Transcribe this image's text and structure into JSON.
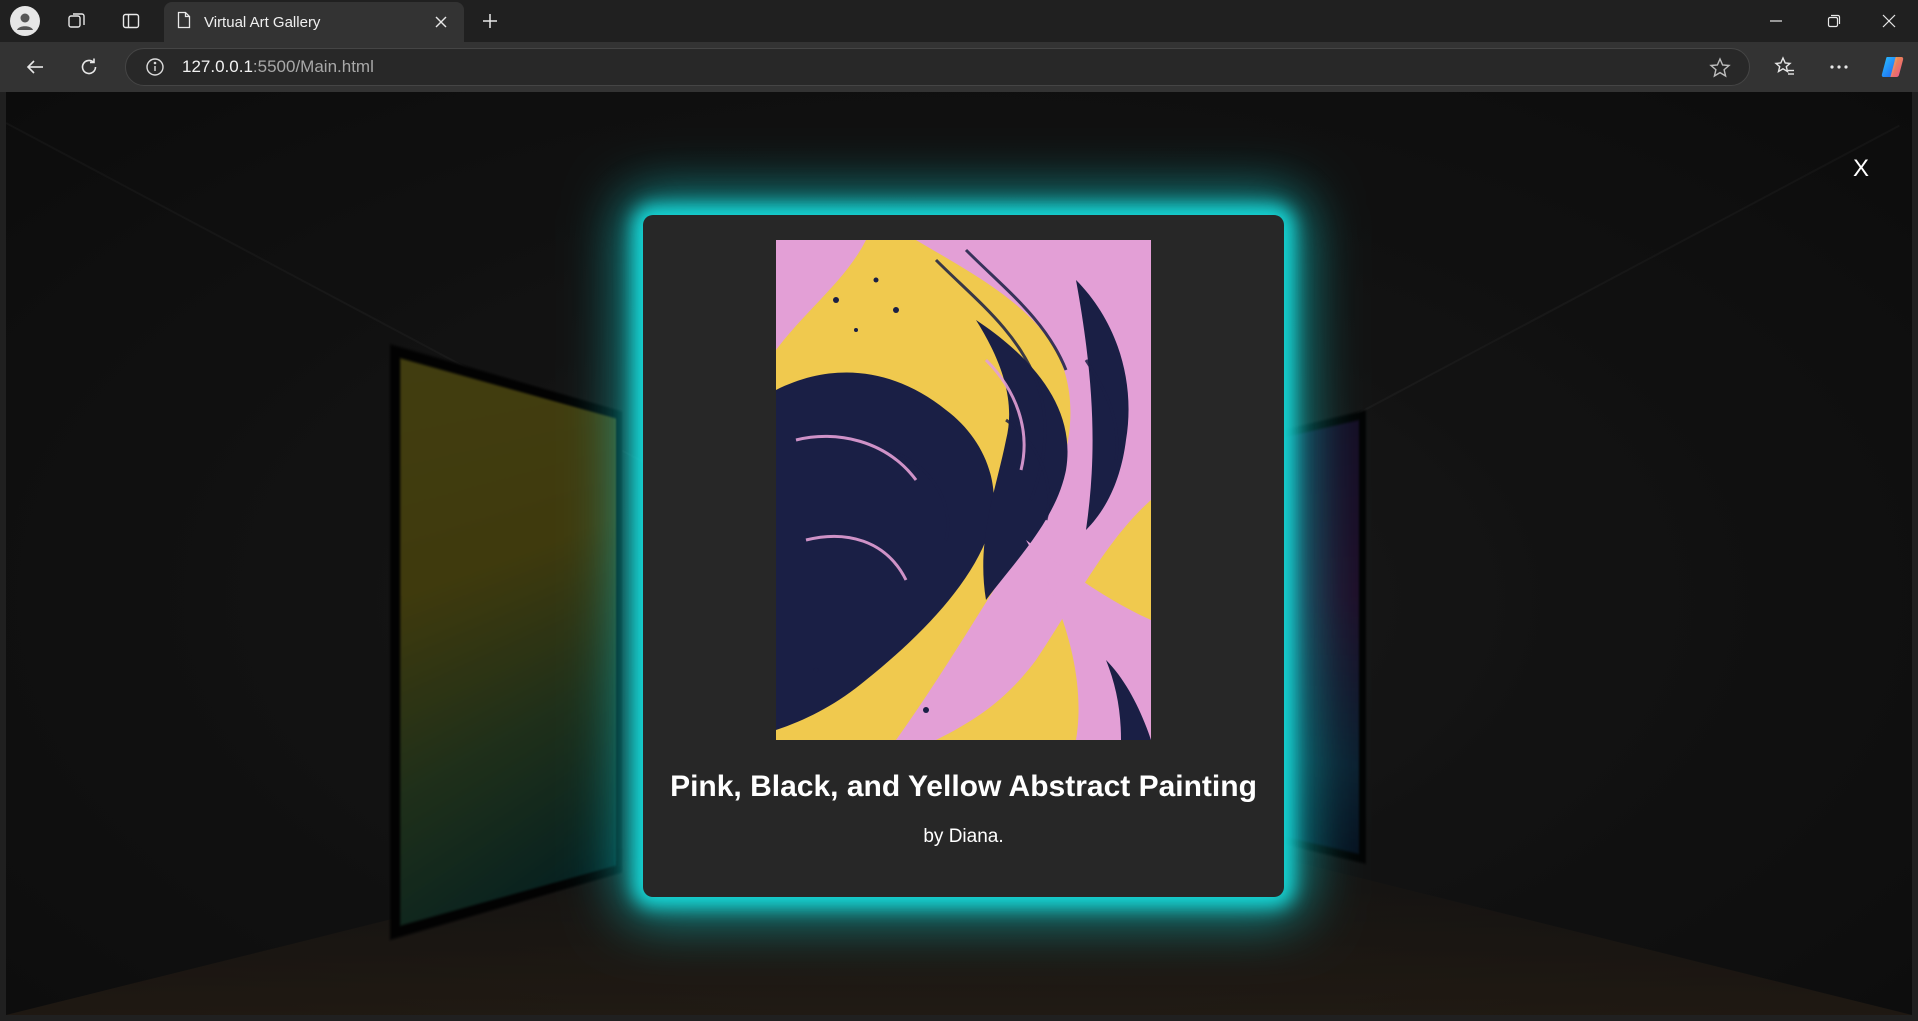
{
  "browser": {
    "tab_title": "Virtual Art Gallery",
    "url_host": "127.0.0.1",
    "url_path": ":5500/Main.html",
    "icons": [
      "profile-icon",
      "workspaces-icon",
      "tab-actions-icon",
      "page-icon",
      "close-icon",
      "new-tab-icon",
      "minimize-icon",
      "restore-icon",
      "window-close-icon",
      "back-icon",
      "refresh-icon",
      "info-icon",
      "favorite-star-icon",
      "favorites-icon",
      "more-icon",
      "copilot-icon"
    ]
  },
  "modal": {
    "close_label": "X",
    "artwork_title": "Pink, Black, and Yellow Abstract Painting",
    "artist": "by Diana.",
    "glow_color": "#17d8d8",
    "artwork_colors": [
      "#f0c94e",
      "#e39fd6",
      "#1a1f45"
    ]
  }
}
